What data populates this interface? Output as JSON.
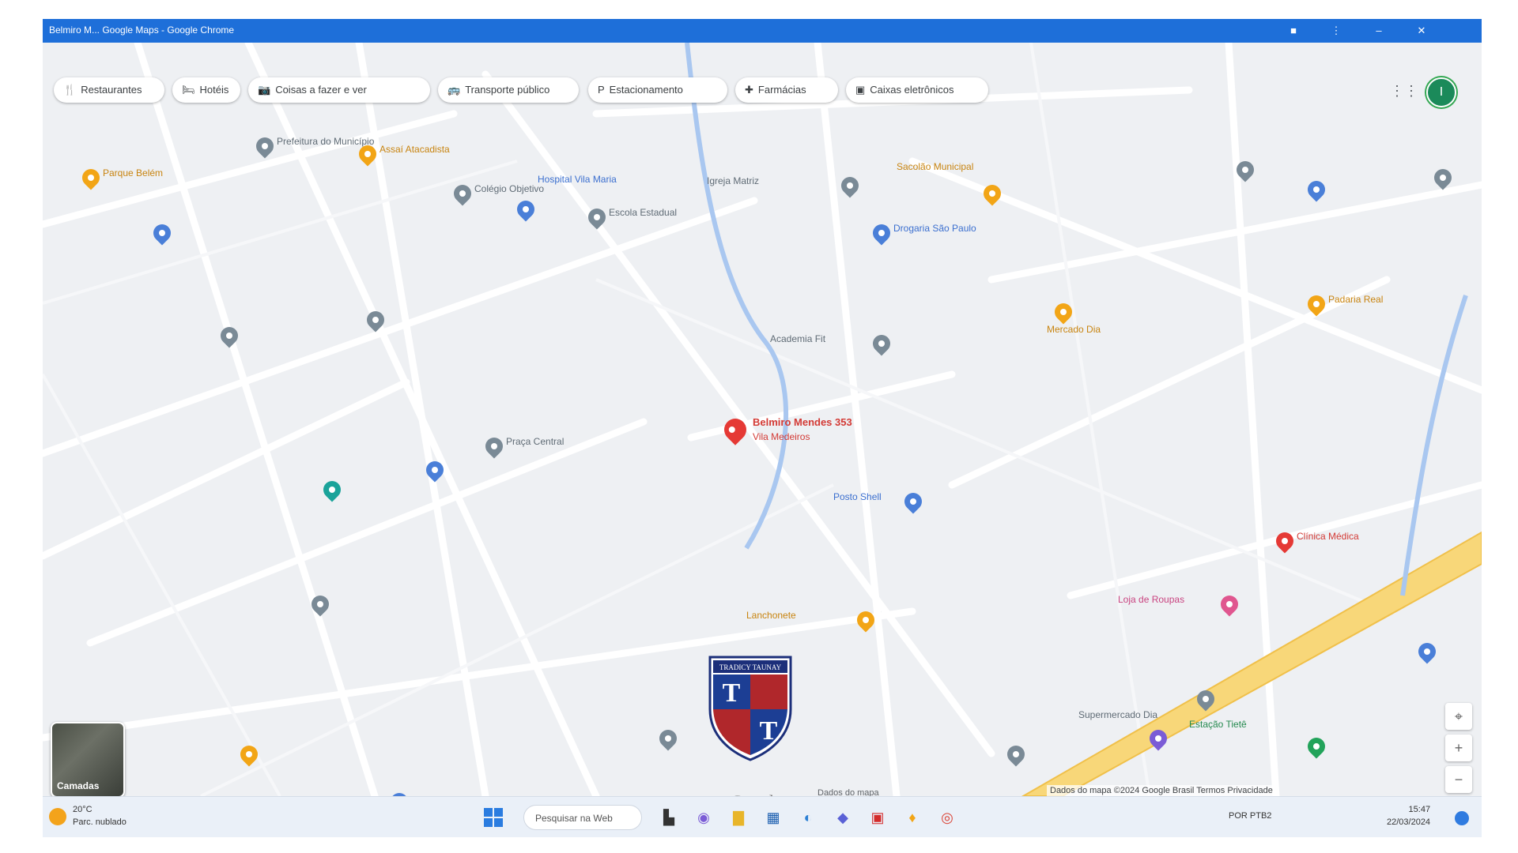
{
  "window": {
    "title": "Belmiro M... Google Maps - Google Chrome"
  },
  "chips": [
    {
      "icon": "fork-knife-icon",
      "glyph": "🍴",
      "label": "Restaurantes"
    },
    {
      "icon": "hotel-icon",
      "glyph": "🛏",
      "label": "Hotéis"
    },
    {
      "icon": "attractions-icon",
      "glyph": "📷",
      "label": "Coisas a fazer e ver"
    },
    {
      "icon": "transit-icon",
      "glyph": "🚌",
      "label": "Transporte público"
    },
    {
      "icon": "parking-icon",
      "glyph": "P",
      "label": "Estacionamento"
    },
    {
      "icon": "pharmacy-icon",
      "glyph": "✚",
      "label": "Farmácias"
    },
    {
      "icon": "atm-icon",
      "glyph": "▣",
      "label": "Caixas eletrônicos"
    }
  ],
  "account": {
    "initial": "I"
  },
  "map": {
    "selected_place": "Belmiro Mendes 353",
    "selected_place_sub": "Vila Medeiros",
    "pois": [
      {
        "name": "Prefeitura do Município",
        "color": "gray"
      },
      {
        "name": "Assaí Atacadista",
        "color": "orange"
      },
      {
        "name": "Parque Belém",
        "color": "orange"
      },
      {
        "name": "Colégio Objetivo",
        "color": "gray"
      },
      {
        "name": "Escola Estadual",
        "color": "gray"
      },
      {
        "name": "Hospital Vila Maria",
        "color": "blue"
      },
      {
        "name": "Sacolão Municipal",
        "color": "orange"
      },
      {
        "name": "Igreja Matriz",
        "color": "gray"
      },
      {
        "name": "Drogaria São Paulo",
        "color": "blue"
      },
      {
        "name": "Mercado Dia",
        "color": "orange"
      },
      {
        "name": "Praça Central",
        "color": "gray"
      },
      {
        "name": "Academia Fit",
        "color": "gray"
      },
      {
        "name": "Posto Shell",
        "color": "blue"
      },
      {
        "name": "Padaria Real",
        "color": "orange"
      },
      {
        "name": "Clínica Médica",
        "color": "red"
      },
      {
        "name": "Loja de Roupas",
        "color": "pink"
      },
      {
        "name": "Lanchonete",
        "color": "orange"
      },
      {
        "name": "Supermercado Dia",
        "color": "gray"
      },
      {
        "name": "Estação Tietê",
        "color": "green"
      }
    ],
    "layers_label": "Camadas",
    "google_caption": "Dados do mapa",
    "attribution": "Dados do mapa ©2024 Google   Brasil   Termos   Privacidade"
  },
  "watermark": {
    "text": "TRADICY TAUNAY",
    "letter": "T"
  },
  "taskbar": {
    "weather_temp": "20°C",
    "weather_desc": "Parc. nublado",
    "search_placeholder": "Pesquisar na Web",
    "tray": "POR  PTB2",
    "time": "15:47",
    "date": "22/03/2024"
  }
}
